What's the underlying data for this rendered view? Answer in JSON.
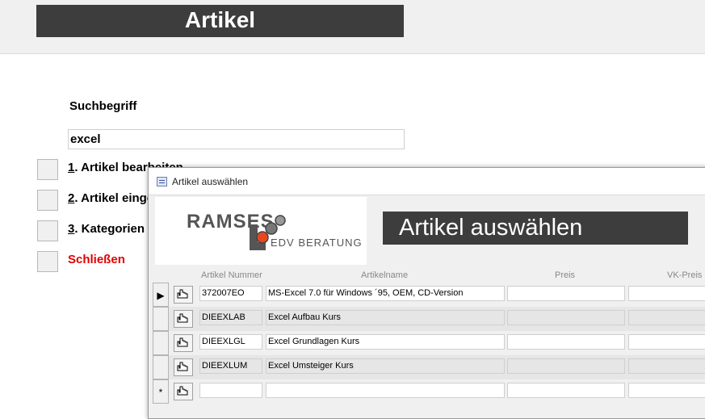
{
  "header": {
    "title": "Artikel"
  },
  "search": {
    "label": "Suchbegriff",
    "value": "excel"
  },
  "menu": [
    {
      "key": "1",
      "rest": ". Artikel bearbeiten"
    },
    {
      "key": "2",
      "rest": ". Artikel eingeben"
    },
    {
      "key": "3",
      "rest": ". Kategorien"
    },
    {
      "label": "Schließen"
    }
  ],
  "popup": {
    "window_title": "Artikel auswählen",
    "logo": {
      "brand": "RAMSES",
      "sub": "EDV BERATUNG"
    },
    "heading": "Artikel auswählen",
    "columns": {
      "nummer": "Artikel Nummer",
      "name": "Artikelname",
      "preis": "Preis",
      "vkpreis": "VK-Preis"
    },
    "rows": [
      {
        "selector": "▶",
        "nummer": "372007EO",
        "name": "MS-Excel 7.0 für Windows ´95, OEM, CD-Version",
        "preis": "",
        "vkpreis": ""
      },
      {
        "selector": "",
        "nummer": "DIEEXLAB",
        "name": "Excel Aufbau Kurs",
        "preis": "",
        "vkpreis": ""
      },
      {
        "selector": "",
        "nummer": "DIEEXLGL",
        "name": "Excel Grundlagen Kurs",
        "preis": "",
        "vkpreis": ""
      },
      {
        "selector": "",
        "nummer": "DIEEXLUM",
        "name": "Excel Umsteiger Kurs",
        "preis": "",
        "vkpreis": ""
      },
      {
        "selector": "*",
        "nummer": "",
        "name": "",
        "preis": "",
        "vkpreis": ""
      }
    ]
  }
}
